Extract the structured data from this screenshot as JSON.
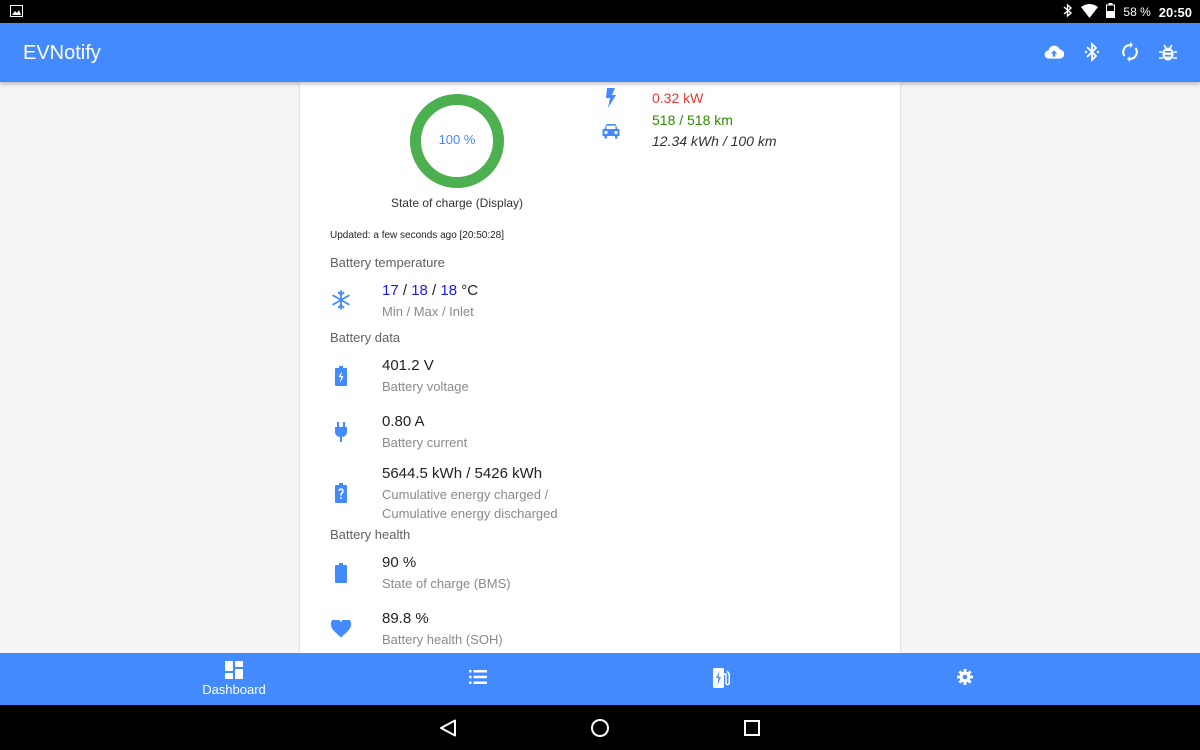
{
  "status_bar": {
    "battery_percent": "58 %",
    "time": "20:50",
    "icons": [
      "image-icon",
      "bluetooth-icon",
      "wifi-icon",
      "battery-icon"
    ]
  },
  "app_bar": {
    "title": "EVNotify",
    "actions": [
      "cloud-upload-icon",
      "bluetooth-icon",
      "sync-icon",
      "bug-icon"
    ]
  },
  "gauge": {
    "value_text": "100 %",
    "caption": "State of charge (Display)",
    "fraction": 1.0,
    "color": "#4caf50"
  },
  "updated": "Updated: a few seconds ago [20:50:28]",
  "right_panel": {
    "power": "0.32 kW",
    "range": "518 / 518 km",
    "consumption": "12.34 kWh / 100 km",
    "power_color": "#e53935",
    "range_color": "#2e8b00"
  },
  "sections": {
    "battery_temperature": {
      "title": "Battery temperature",
      "min": "17",
      "sep1": " / ",
      "max": "18",
      "sep2": " / ",
      "inlet": "18",
      "unit": " °C",
      "label": "Min / Max / Inlet"
    },
    "battery_data": {
      "title": "Battery data",
      "voltage_value": "401.2 V",
      "voltage_label": "Battery voltage",
      "current_value": "0.80 A",
      "current_label": "Battery current",
      "energy_value": "5644.5 kWh / 5426 kWh",
      "energy_label_1": "Cumulative energy charged /",
      "energy_label_2": "Cumulative energy discharged"
    },
    "battery_health": {
      "title": "Battery health",
      "soc_value": "90 %",
      "soc_label": "State of charge (BMS)",
      "soh_value": "89.8 %",
      "soh_label": "Battery health (SOH)"
    }
  },
  "bottom_nav": {
    "tabs": [
      {
        "label": "Dashboard",
        "icon": "dashboard-icon"
      },
      {
        "label": "",
        "icon": "list-icon"
      },
      {
        "label": "",
        "icon": "ev-station-icon"
      },
      {
        "label": "",
        "icon": "settings-icon"
      }
    ]
  },
  "colors": {
    "primary": "#448aff",
    "icon_blue": "#448aff",
    "temp_value": "#1a1aff"
  }
}
